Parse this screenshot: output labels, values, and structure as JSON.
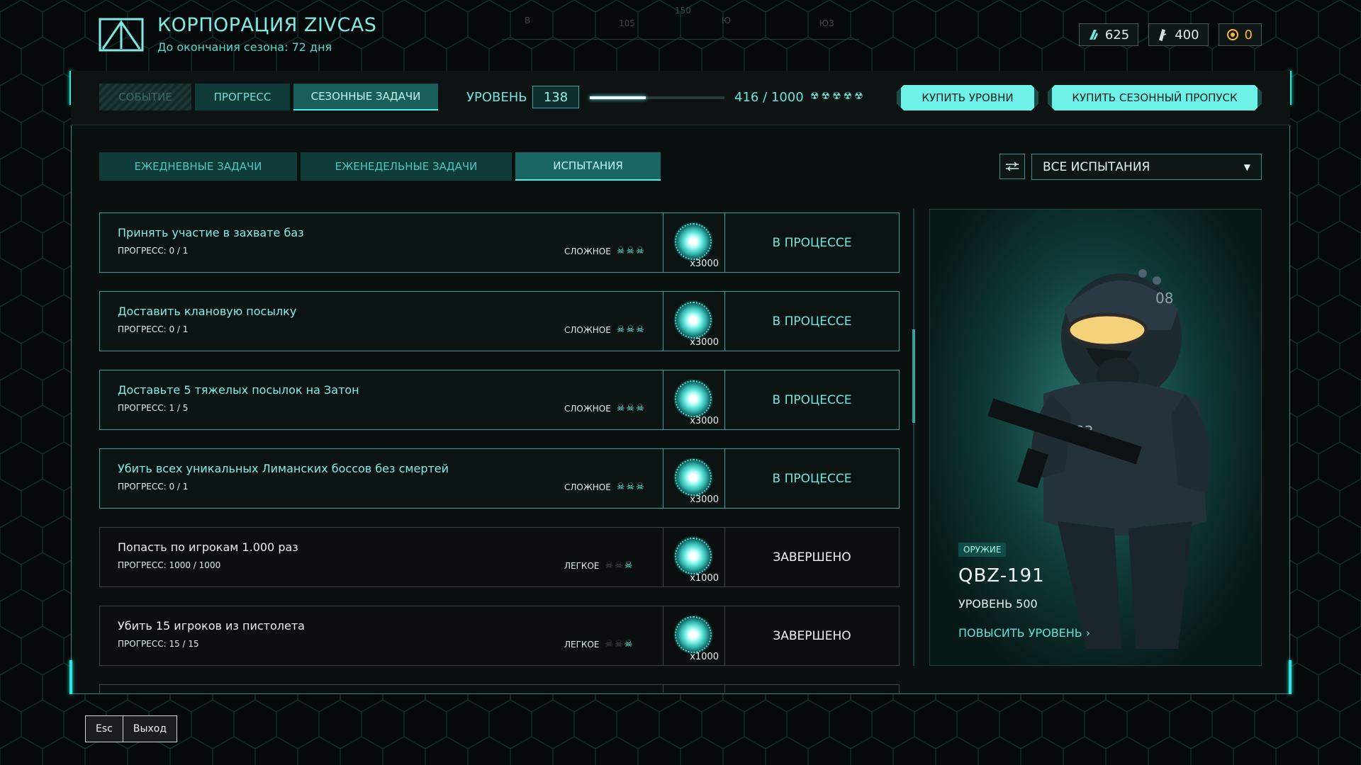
{
  "header": {
    "title": "КОРПОРАЦИЯ ZIVCAS",
    "season_left": "До окончания сезона: 72 дня"
  },
  "compass": {
    "labels": [
      "В",
      "105",
      "150",
      "Ю",
      "ЮЗ"
    ]
  },
  "currencies": [
    {
      "icon": "crystal-icon",
      "value": "625"
    },
    {
      "icon": "token-icon",
      "value": "400"
    },
    {
      "icon": "coin-icon",
      "value": "0",
      "color": "#ffb932"
    }
  ],
  "topbar": {
    "tabs": [
      "СОБЫТИЕ",
      "ПРОГРЕСС",
      "СЕЗОННЫЕ ЗАДАЧИ"
    ],
    "level_label": "УРОВЕНЬ",
    "level": "138",
    "xp_text": "416 / 1000",
    "xp_fraction": 0.416,
    "buy_levels": "КУПИТЬ УРОВНИ",
    "buy_pass": "КУПИТЬ СЕЗОННЫЙ ПРОПУСК"
  },
  "subtabs": [
    "ЕЖЕДНЕВНЫЕ ЗАДАЧИ",
    "ЕЖЕНЕДЕЛЬНЫЕ ЗАДАЧИ",
    "ИСПЫТАНИЯ"
  ],
  "filter": {
    "selected": "ВСЕ ИСПЫТАНИЯ"
  },
  "tasks": [
    {
      "name": "Принять участие в захвате баз",
      "progress": "ПРОГРЕСС: 0 / 1",
      "difficulty": "СЛОЖНОЕ",
      "skulls": 3,
      "reward": "x3000",
      "status": "В ПРОЦЕССЕ"
    },
    {
      "name": "Доставить клановую посылку",
      "progress": "ПРОГРЕСС: 0 / 1",
      "difficulty": "СЛОЖНОЕ",
      "skulls": 3,
      "reward": "x3000",
      "status": "В ПРОЦЕССЕ"
    },
    {
      "name": "Доставьте 5 тяжелых посылок на Затон",
      "progress": "ПРОГРЕСС: 1 / 5",
      "difficulty": "СЛОЖНОЕ",
      "skulls": 3,
      "reward": "x3000",
      "status": "В ПРОЦЕССЕ"
    },
    {
      "name": "Убить всех уникальных Лиманских боссов без смертей",
      "progress": "ПРОГРЕСС: 0 / 1",
      "difficulty": "СЛОЖНОЕ",
      "skulls": 3,
      "reward": "x3000",
      "status": "В ПРОЦЕССЕ"
    },
    {
      "name": "Попасть по игрокам 1.000 раз",
      "progress": "ПРОГРЕСС: 1000 / 1000",
      "difficulty": "ЛЕГКОЕ",
      "skulls": 1,
      "reward": "x1000",
      "status": "ЗАВЕРШЕНО"
    },
    {
      "name": "Убить 15 игроков из пистолета",
      "progress": "ПРОГРЕСС: 15 / 15",
      "difficulty": "ЛЕГКОЕ",
      "skulls": 1,
      "reward": "x1000",
      "status": "ЗАВЕРШЕНО"
    }
  ],
  "card": {
    "badge": "ОРУЖИЕ",
    "name": "QBZ-191",
    "level": "УРОВЕНЬ 500",
    "upgrade": "ПОВЫСИТЬ УРОВЕНЬ"
  },
  "footer": {
    "esc_key": "Esc",
    "exit_label": "Выход"
  }
}
